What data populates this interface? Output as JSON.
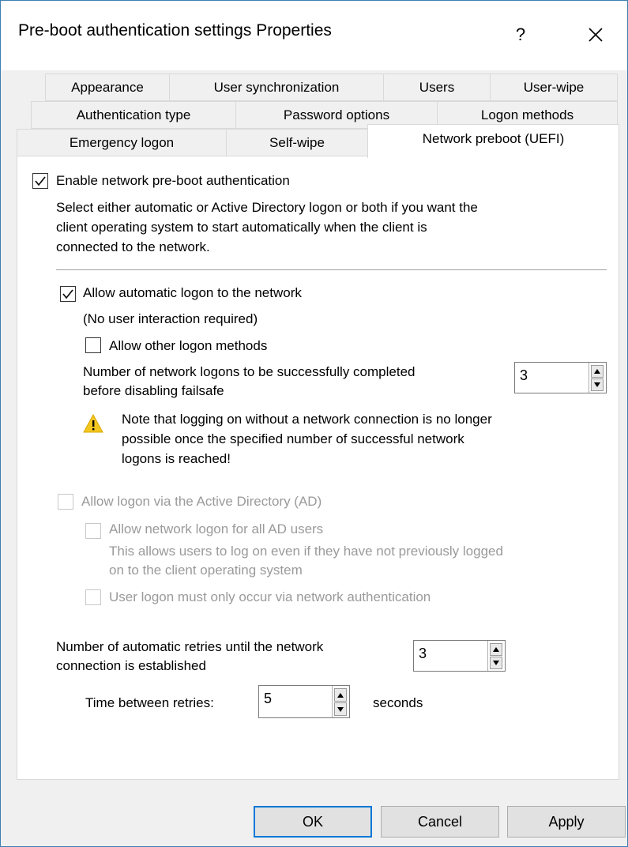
{
  "window": {
    "title": "Pre-boot authentication settings Properties",
    "help_label": "?"
  },
  "tabs": {
    "row1": [
      "Appearance",
      "User synchronization",
      "Users",
      "User-wipe"
    ],
    "row2": [
      "Authentication type",
      "Password options",
      "Logon methods"
    ],
    "row3": [
      "Emergency logon",
      "Self-wipe",
      "Network preboot (UEFI)"
    ],
    "active": "Network preboot (UEFI)"
  },
  "network_preboot": {
    "enable_label": "Enable network pre-boot authentication",
    "enable_checked": true,
    "description_lines": [
      "Select either automatic or Active Directory logon or both if you want the",
      "client operating system to start automatically when the client is",
      "connected to the network."
    ],
    "auto_logon": {
      "label": "Allow automatic logon to the network",
      "checked": true,
      "sublabel": "(No user interaction required)",
      "other_methods_label": "Allow other logon methods",
      "other_methods_checked": false,
      "failsafe_label_lines": [
        "Number of network logons to be successfully completed",
        "before disabling failsafe"
      ],
      "failsafe_value": "3",
      "warning_lines": [
        "Note that logging on without a network connection is no longer",
        "possible once the specified number of successful network",
        "logons is reached!"
      ]
    },
    "ad_logon": {
      "label": "Allow logon via the Active Directory (AD)",
      "checked": false,
      "enabled": false,
      "all_users_label": "Allow network logon for all AD users",
      "all_users_desc_lines": [
        "This allows users to log on even if they have not previously logged",
        "on to the client operating system"
      ],
      "network_only_label": "User logon must only occur via network authentication"
    },
    "retries": {
      "label_lines": [
        "Number of automatic retries until the network",
        "connection is established"
      ],
      "value": "3",
      "time_label": "Time between retries:",
      "time_value": "5",
      "time_unit": "seconds"
    }
  },
  "buttons": {
    "ok": "OK",
    "cancel": "Cancel",
    "apply": "Apply"
  },
  "colors": {
    "window_border": "#3c7fb1",
    "default_button_border": "#0078d7",
    "warning_yellow": "#f4c620",
    "disabled_text": "#9a9a9a"
  }
}
